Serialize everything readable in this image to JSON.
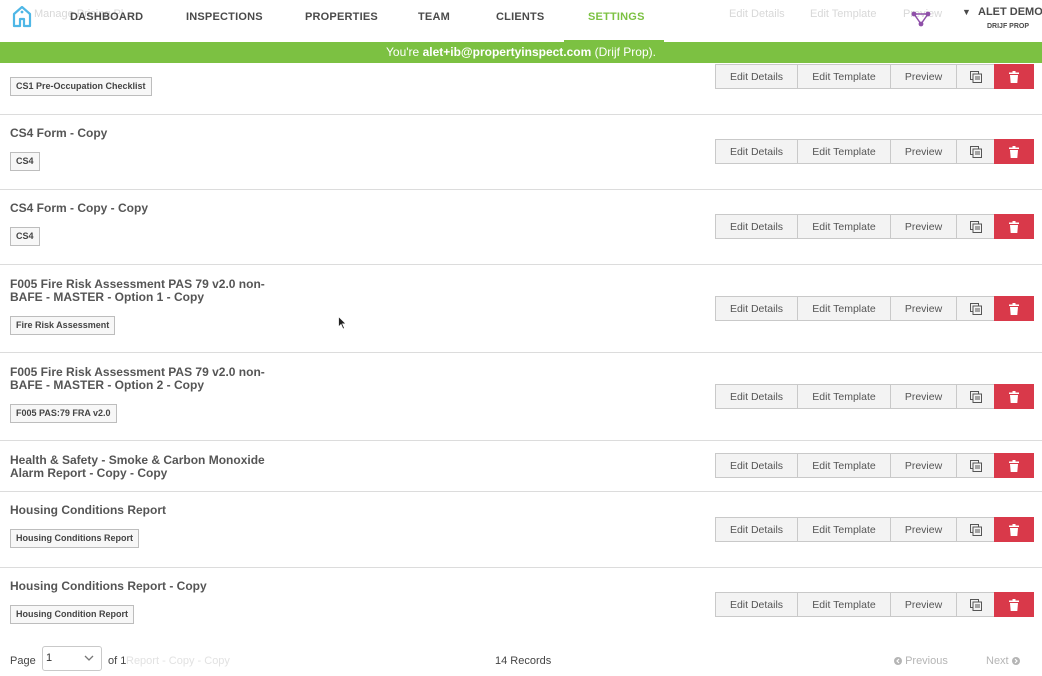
{
  "nav": {
    "items": [
      {
        "label": "DASHBOARD",
        "active": false
      },
      {
        "label": "INSPECTIONS",
        "active": false
      },
      {
        "label": "PROPERTIES",
        "active": false
      },
      {
        "label": "TEAM",
        "active": false
      },
      {
        "label": "CLIENTS",
        "active": false
      },
      {
        "label": "SETTINGS",
        "active": true
      }
    ],
    "ghost_text_left": "Manage Pricing Pl",
    "ghost_text_right": "Edit Details",
    "ghost_text_right2": "Edit Template",
    "ghost_text_right3": "Preview",
    "user": {
      "name": "ALET DEMO",
      "org": "DRIJF PROP"
    },
    "accent_color": "#7cc142"
  },
  "banner": {
    "prefix": "You're ",
    "email": "alet+ib@propertyinspect.com",
    "suffix": " (Drijf Prop)."
  },
  "actions": {
    "edit_details": "Edit Details",
    "edit_template": "Edit Template",
    "preview": "Preview",
    "copy_icon": "copy-icon",
    "delete_icon": "trash-icon",
    "delete_color": "#d9394a"
  },
  "templates": [
    {
      "title": "",
      "tag": "CS1 Pre-Occupation Checklist"
    },
    {
      "title": "CS4 Form - Copy",
      "tag": "CS4"
    },
    {
      "title": "CS4 Form - Copy - Copy",
      "tag": "CS4"
    },
    {
      "title": "F005 Fire Risk Assessment PAS 79 v2.0 non-BAFE - MASTER - Option 1 - Copy",
      "tag": "Fire Risk Assessment"
    },
    {
      "title": "F005 Fire Risk Assessment PAS 79 v2.0 non-BAFE - MASTER - Option 2 - Copy",
      "tag": "F005 PAS:79 FRA v2.0"
    },
    {
      "title": "Health & Safety - Smoke & Carbon Monoxide Alarm Report - Copy - Copy",
      "tag": ""
    },
    {
      "title": "Housing Conditions Report",
      "tag": "Housing Conditions Report"
    },
    {
      "title": "Housing Conditions Report - Copy",
      "tag": "Housing Condition Report"
    }
  ],
  "pagination": {
    "page_label": "Page",
    "page_value": "1",
    "of_label": "of 1",
    "ghost_text": "Report - Copy - Copy",
    "records": "14 Records",
    "previous": "Previous",
    "next": "Next"
  }
}
